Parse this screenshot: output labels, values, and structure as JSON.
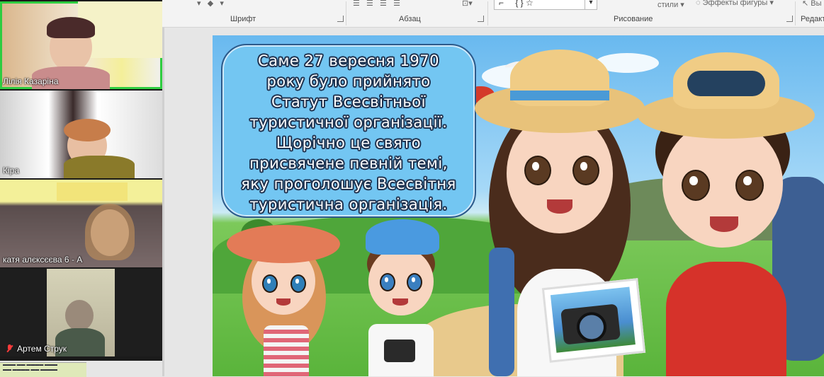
{
  "ribbon": {
    "groups": {
      "font": "Шрифт",
      "paragraph": "Абзац",
      "drawing": "Рисование",
      "editing": "Редакт"
    },
    "styles_label": "стили",
    "shape_effects_label": "Эффекты фигуры",
    "select_label": "Вы"
  },
  "slide": {
    "text_lines": [
      "Саме 27 вересня 1970",
      "року було прийнято",
      "Статут Всесвітньої",
      "туристичної організації.",
      "Щорічно це свято",
      "присвячене певній темі,",
      "яку проголошує Всесвітня",
      "туристична організація."
    ]
  },
  "participants": [
    {
      "name": "Лілія Казаріна",
      "active": true,
      "muted": false
    },
    {
      "name": "Кіра",
      "active": false,
      "muted": false
    },
    {
      "name": "катя алєксєєва 6 - А",
      "active": false,
      "muted": false
    },
    {
      "name": "Артем Струк",
      "active": false,
      "muted": true
    }
  ],
  "colors": {
    "active_speaker_border": "#2ecc40",
    "speech_bubble": "#73c6f2",
    "muted_icon": "#ff3b3b"
  }
}
